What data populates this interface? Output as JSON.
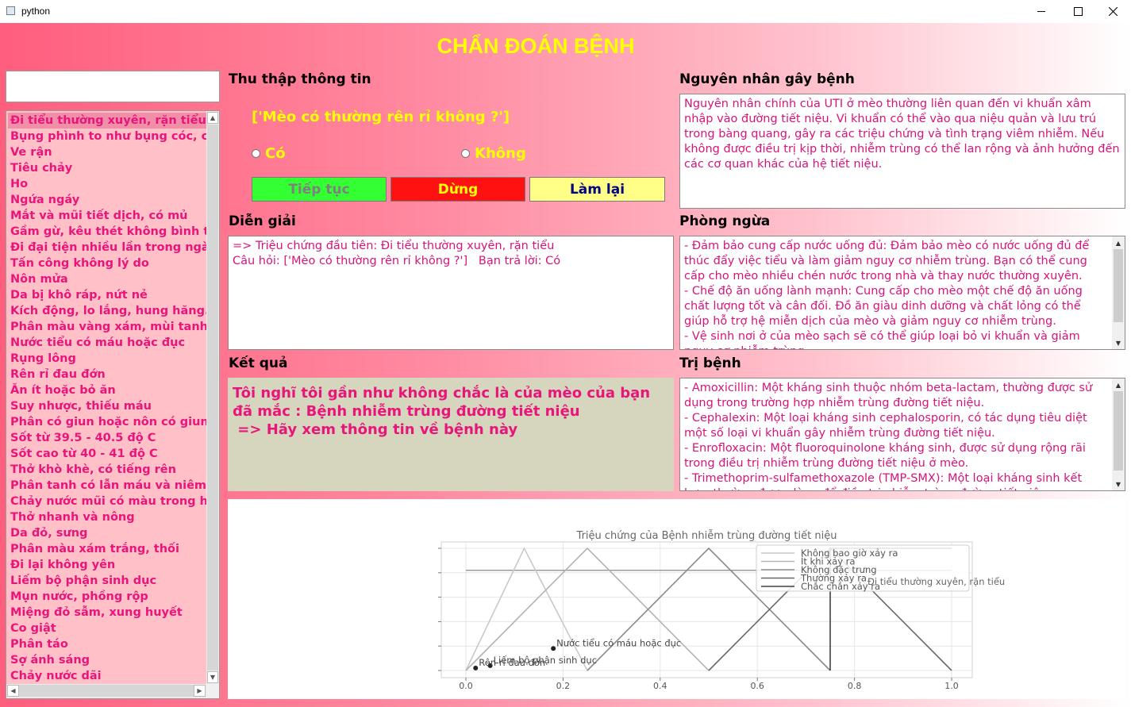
{
  "window": {
    "title": "python",
    "icon": "app-icon"
  },
  "heading": "CHẨN ĐOÁN BỆNH",
  "search": {
    "value": ""
  },
  "symptoms": [
    "Đi tiểu thường xuyên, rặn tiểu",
    "Bụng phình to như bụng cóc, căng",
    "Ve rận",
    "Tiêu chảy",
    "Ho",
    "Ngứa ngáy",
    "Mắt và mũi tiết dịch, có mủ",
    "Gầm gừ, kêu thét không bình thường",
    "Đi đại tiện nhiều lần trong ngày",
    "Tấn công không lý do",
    "Nôn mửa",
    "Da bị khô ráp, nứt nẻ",
    "Kích động, lo lắng, hung hăng.",
    "Phân màu vàng xám, mùi tanh",
    "Nước tiểu có máu hoặc đục",
    "Rụng lông",
    "Rên rỉ đau đớn",
    "Ăn ít hoặc bỏ ăn",
    "Suy nhược, thiếu máu",
    "Phân có giun hoặc nôn có giun",
    "Sốt từ 39.5 - 40.5 độ C",
    "Sốt cao từ 40 - 41 độ C",
    "Thở khò khè, có tiếng rên",
    "Phân tanh có lẫn máu và niêm mạc",
    "Chảy nước mũi có màu trong hoặc",
    "Thở nhanh và nông",
    "Da đỏ, sưng",
    "Phân màu xám trắng, thối",
    "Đi lại không yên",
    "Liếm bộ phận sinh dục",
    "Mụn nước, phồng rộp",
    "Miệng đỏ sẫm, xung huyết",
    "Co giật",
    "Phân táo",
    "Sợ ánh sáng",
    "Chảy nước dãi"
  ],
  "labels": {
    "collect": "Thu thập thông tin",
    "cause": "Nguyên nhân gây bệnh",
    "explain": "Diễn giải",
    "prevent": "Phòng ngừa",
    "result": "Kết quả",
    "treat": "Trị bệnh"
  },
  "question": "['Mèo có thường rên rỉ không ?']",
  "options": {
    "yes": "Có",
    "no": "Không"
  },
  "buttons": {
    "continue": "Tiếp tục",
    "stop": "Dừng",
    "reset": "Làm lại"
  },
  "colors": {
    "continue_bg": "#33ff33",
    "stop_bg": "#ff1111",
    "reset_bg": "#ffff88",
    "text_pink": "#e8157a"
  },
  "cause_text": "Nguyên nhân chính của UTI ở mèo thường liên quan đến vi khuẩn xâm nhập vào đường tiết niệu. Vi khuẩn có thể vào qua niệu quản và lưu trú trong bàng quang, gây ra các triệu chứng và tình trạng viêm nhiễm. Nếu không được điều trị kịp thời, nhiễm trùng có thể lan rộng và ảnh hưởng đến các cơ quan khác của hệ tiết niệu.",
  "explain_lines": [
    "=> Triệu chứng đầu tiên: Đi tiểu thường xuyên, rặn tiểu",
    "Câu hỏi: ['Mèo có thường rên rỉ không ?']   Bạn trả lời: Có"
  ],
  "prevent_lines": [
    "- Đảm bảo cung cấp nước uống đủ: Đảm bảo mèo có nước uống đủ để thúc đẩy việc tiểu và làm giảm nguy cơ nhiễm trùng. Bạn có thể cung cấp cho mèo nhiều chén nước trong nhà và thay nước thường xuyên.",
    "- Chế độ ăn uống lành mạnh: Cung cấp cho mèo một chế độ ăn uống chất lượng tốt và cân đối. Đồ ăn giàu dinh dưỡng và chất lỏng có thể giúp hỗ trợ hệ miễn dịch của mèo và giảm nguy cơ nhiễm trùng.",
    "- Vệ sinh nơi ở của mèo sạch sẽ có thể giúp loại bỏ vi khuẩn và giảm nguy cơ nhiễm trùng."
  ],
  "result_text": "Tôi nghĩ tôi gần như không chắc là của mèo của bạn đã mắc : Bệnh nhiễm trùng đường tiết niệu\n => Hãy xem thông tin về bệnh này",
  "treat_lines": [
    "- Amoxicillin: Một kháng sinh thuộc nhóm beta-lactam, thường được sử dụng trong trường hợp nhiễm trùng đường tiết niệu.",
    "- Cephalexin: Một loại kháng sinh cephalosporin, có tác dụng tiêu diệt một số loại vi khuẩn gây nhiễm trùng đường tiết niệu.",
    "- Enrofloxacin: Một fluoroquinolone kháng sinh, được sử dụng rộng rãi trong điều trị nhiễm trùng đường tiết niệu ở mèo.",
    "- Trimethoprim-sulfamethoxazole (TMP-SMX): Một loại kháng sinh kết hợp, thường được dùng để điều trị nhiễm trùng đường tiết niệu."
  ],
  "chart_data": {
    "type": "line",
    "title": "Triệu chứng của Bệnh nhiễm trùng đường tiết niệu",
    "xlim": [
      0.0,
      1.0
    ],
    "ylim": [
      0.0,
      1.0
    ],
    "x_ticks": [
      "0.0",
      "0.2",
      "0.4",
      "0.6",
      "0.8",
      "1.0"
    ],
    "grid": true,
    "legend_position": "top-right",
    "series": [
      {
        "name": "Không bao giờ xảy ra",
        "x": [
          0.0,
          0.12,
          0.25
        ],
        "y": [
          0.0,
          1.0,
          0.0
        ],
        "color": "#c9c9c9"
      },
      {
        "name": "Ít khi xảy ra",
        "x": [
          0.0,
          0.25,
          0.5
        ],
        "y": [
          0.0,
          1.0,
          0.0
        ],
        "color": "#b3b3b3"
      },
      {
        "name": "Không đặc trưng",
        "x": [
          0.25,
          0.5,
          0.75
        ],
        "y": [
          0.0,
          1.0,
          0.0
        ],
        "color": "#8a8a8a"
      },
      {
        "name": "Thường xảy ra",
        "x": [
          0.5,
          0.75,
          1.0
        ],
        "y": [
          0.0,
          1.0,
          0.0
        ],
        "color": "#6a6a6a"
      },
      {
        "name": "Chắc chắn xảy ra",
        "x": [
          0.75,
          0.75,
          1.0
        ],
        "y": [
          0.0,
          1.0,
          1.0
        ],
        "color": "#404040"
      }
    ],
    "reference_line": {
      "name": "Đi tiểu thường xuyên, rặn tiểu",
      "x": [
        0.0,
        1.0
      ],
      "y": [
        0.82,
        0.82
      ],
      "color": "#888888"
    },
    "points": [
      {
        "label": "Nước tiểu có máu hoặc đục",
        "x": 0.18,
        "y": 0.18
      },
      {
        "label": "Liếm bộ phận sinh dục",
        "x": 0.05,
        "y": 0.04
      },
      {
        "label": "Rên rỉ đau đớn",
        "x": 0.02,
        "y": 0.02
      }
    ]
  }
}
